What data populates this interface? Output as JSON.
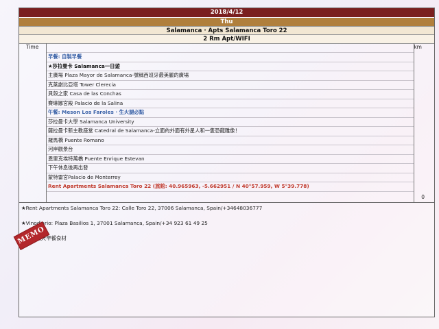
{
  "header": {
    "date": "2018/4/12",
    "weekday": "Thu",
    "location": "Salamanca · Apts Salamanca Toro 22",
    "room": "2 Rm Apt/WIFI"
  },
  "columns": {
    "time": "Time",
    "km": "km"
  },
  "itinerary": [
    {
      "text": "早餐: 自製早餐",
      "style": "meal"
    },
    {
      "text": "★莎拉曼卡 Salamanca一日遊",
      "style": "bold"
    },
    {
      "text": "主廣場 Plaza Mayor de Salamanca-號稱西班牙最美麗的廣場",
      "style": ""
    },
    {
      "text": "克萊謝比亞塔 Tower Clerecia",
      "style": ""
    },
    {
      "text": "貝殼之家 Casa de las Conchas",
      "style": ""
    },
    {
      "text": "賽琳娜宮殿 Palacio de la Salina",
      "style": ""
    },
    {
      "text": "午餐: Meson Los Faroles · 生火腿必點",
      "style": "meal"
    },
    {
      "text": "莎拉曼卡大學 Salamanca University",
      "style": ""
    },
    {
      "text": "薩拉曼卡新主教座堂 Catedral de Salamanca-立面的外面有外星人和一隻恐龍雕像！",
      "style": ""
    },
    {
      "text": "羅馬橋 Puente Romano",
      "style": ""
    },
    {
      "text": "河岸觀景台",
      "style": ""
    },
    {
      "text": "恩里克埃特萬橋 Puente Enrique Estevan",
      "style": ""
    },
    {
      "text": "下午休息後再出發",
      "style": ""
    },
    {
      "text": "蒙特雷宮Palacio de Monterrey",
      "style": ""
    },
    {
      "text": "Rent Apartments Salamanca Toro 22 (旅館: 40.965963, -5.662951 / N 40°57.959, W 5°39.778)",
      "style": "hotel"
    }
  ],
  "total_km": "0",
  "notes": {
    "rent": "★Rent Apartments Salamanca Toro 22: Calle Toro 22, 37006 Salamanca, Spain/+34648036777",
    "vinodiario": "★Vinodiario: Plaza Basilios 1, 37001 Salamanca, Spain/+34 923 61 49 25",
    "buy": "★買好隔天早餐食材"
  },
  "stamp": "MEMO",
  "colors": {
    "date_band": "#7a1f1f",
    "weekday_band": "#b07f3c",
    "meal_text": "#3b63a8",
    "hotel_text": "#c0392b",
    "stamp": "#b3272b"
  }
}
